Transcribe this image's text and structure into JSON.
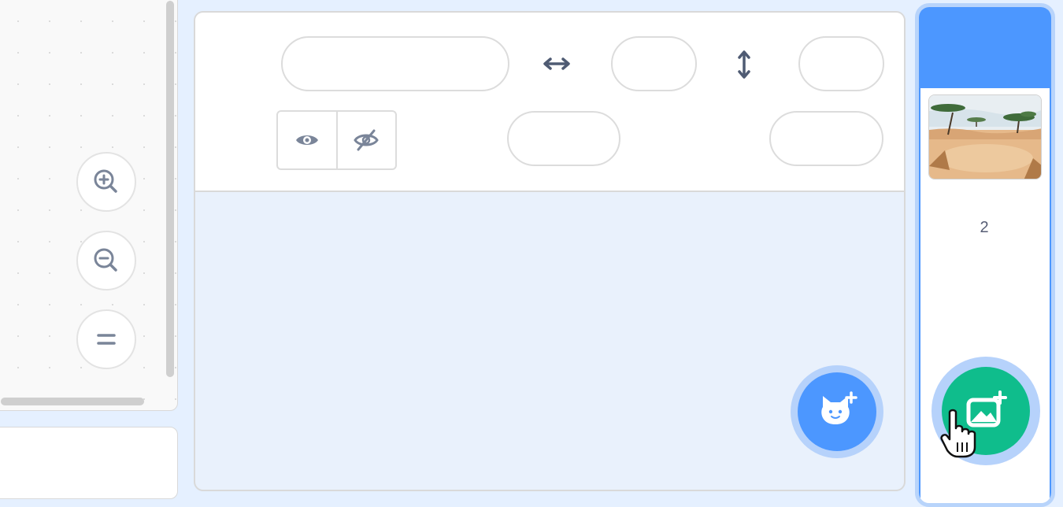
{
  "workspace": {
    "zoom_in": "zoom-in",
    "zoom_out": "zoom-out",
    "reset_zoom": "reset-zoom"
  },
  "sprite_info": {
    "sprite_name": {
      "value": "",
      "placeholder": ""
    },
    "x_value": "",
    "y_value": "",
    "show_visible_icon": "eye-icon",
    "show_hidden_icon": "eye-slash-icon",
    "size_value": "",
    "direction_value": ""
  },
  "buttons": {
    "choose_sprite_icon": "cat-plus-icon",
    "choose_backdrop_icon": "image-plus-icon"
  },
  "stage": {
    "backdrops_count": "2"
  },
  "colors": {
    "accent": "#4c97ff",
    "backdrop_button": "#0fbd8c",
    "panel_bg": "#e5f0ff",
    "text": "#575e75"
  }
}
